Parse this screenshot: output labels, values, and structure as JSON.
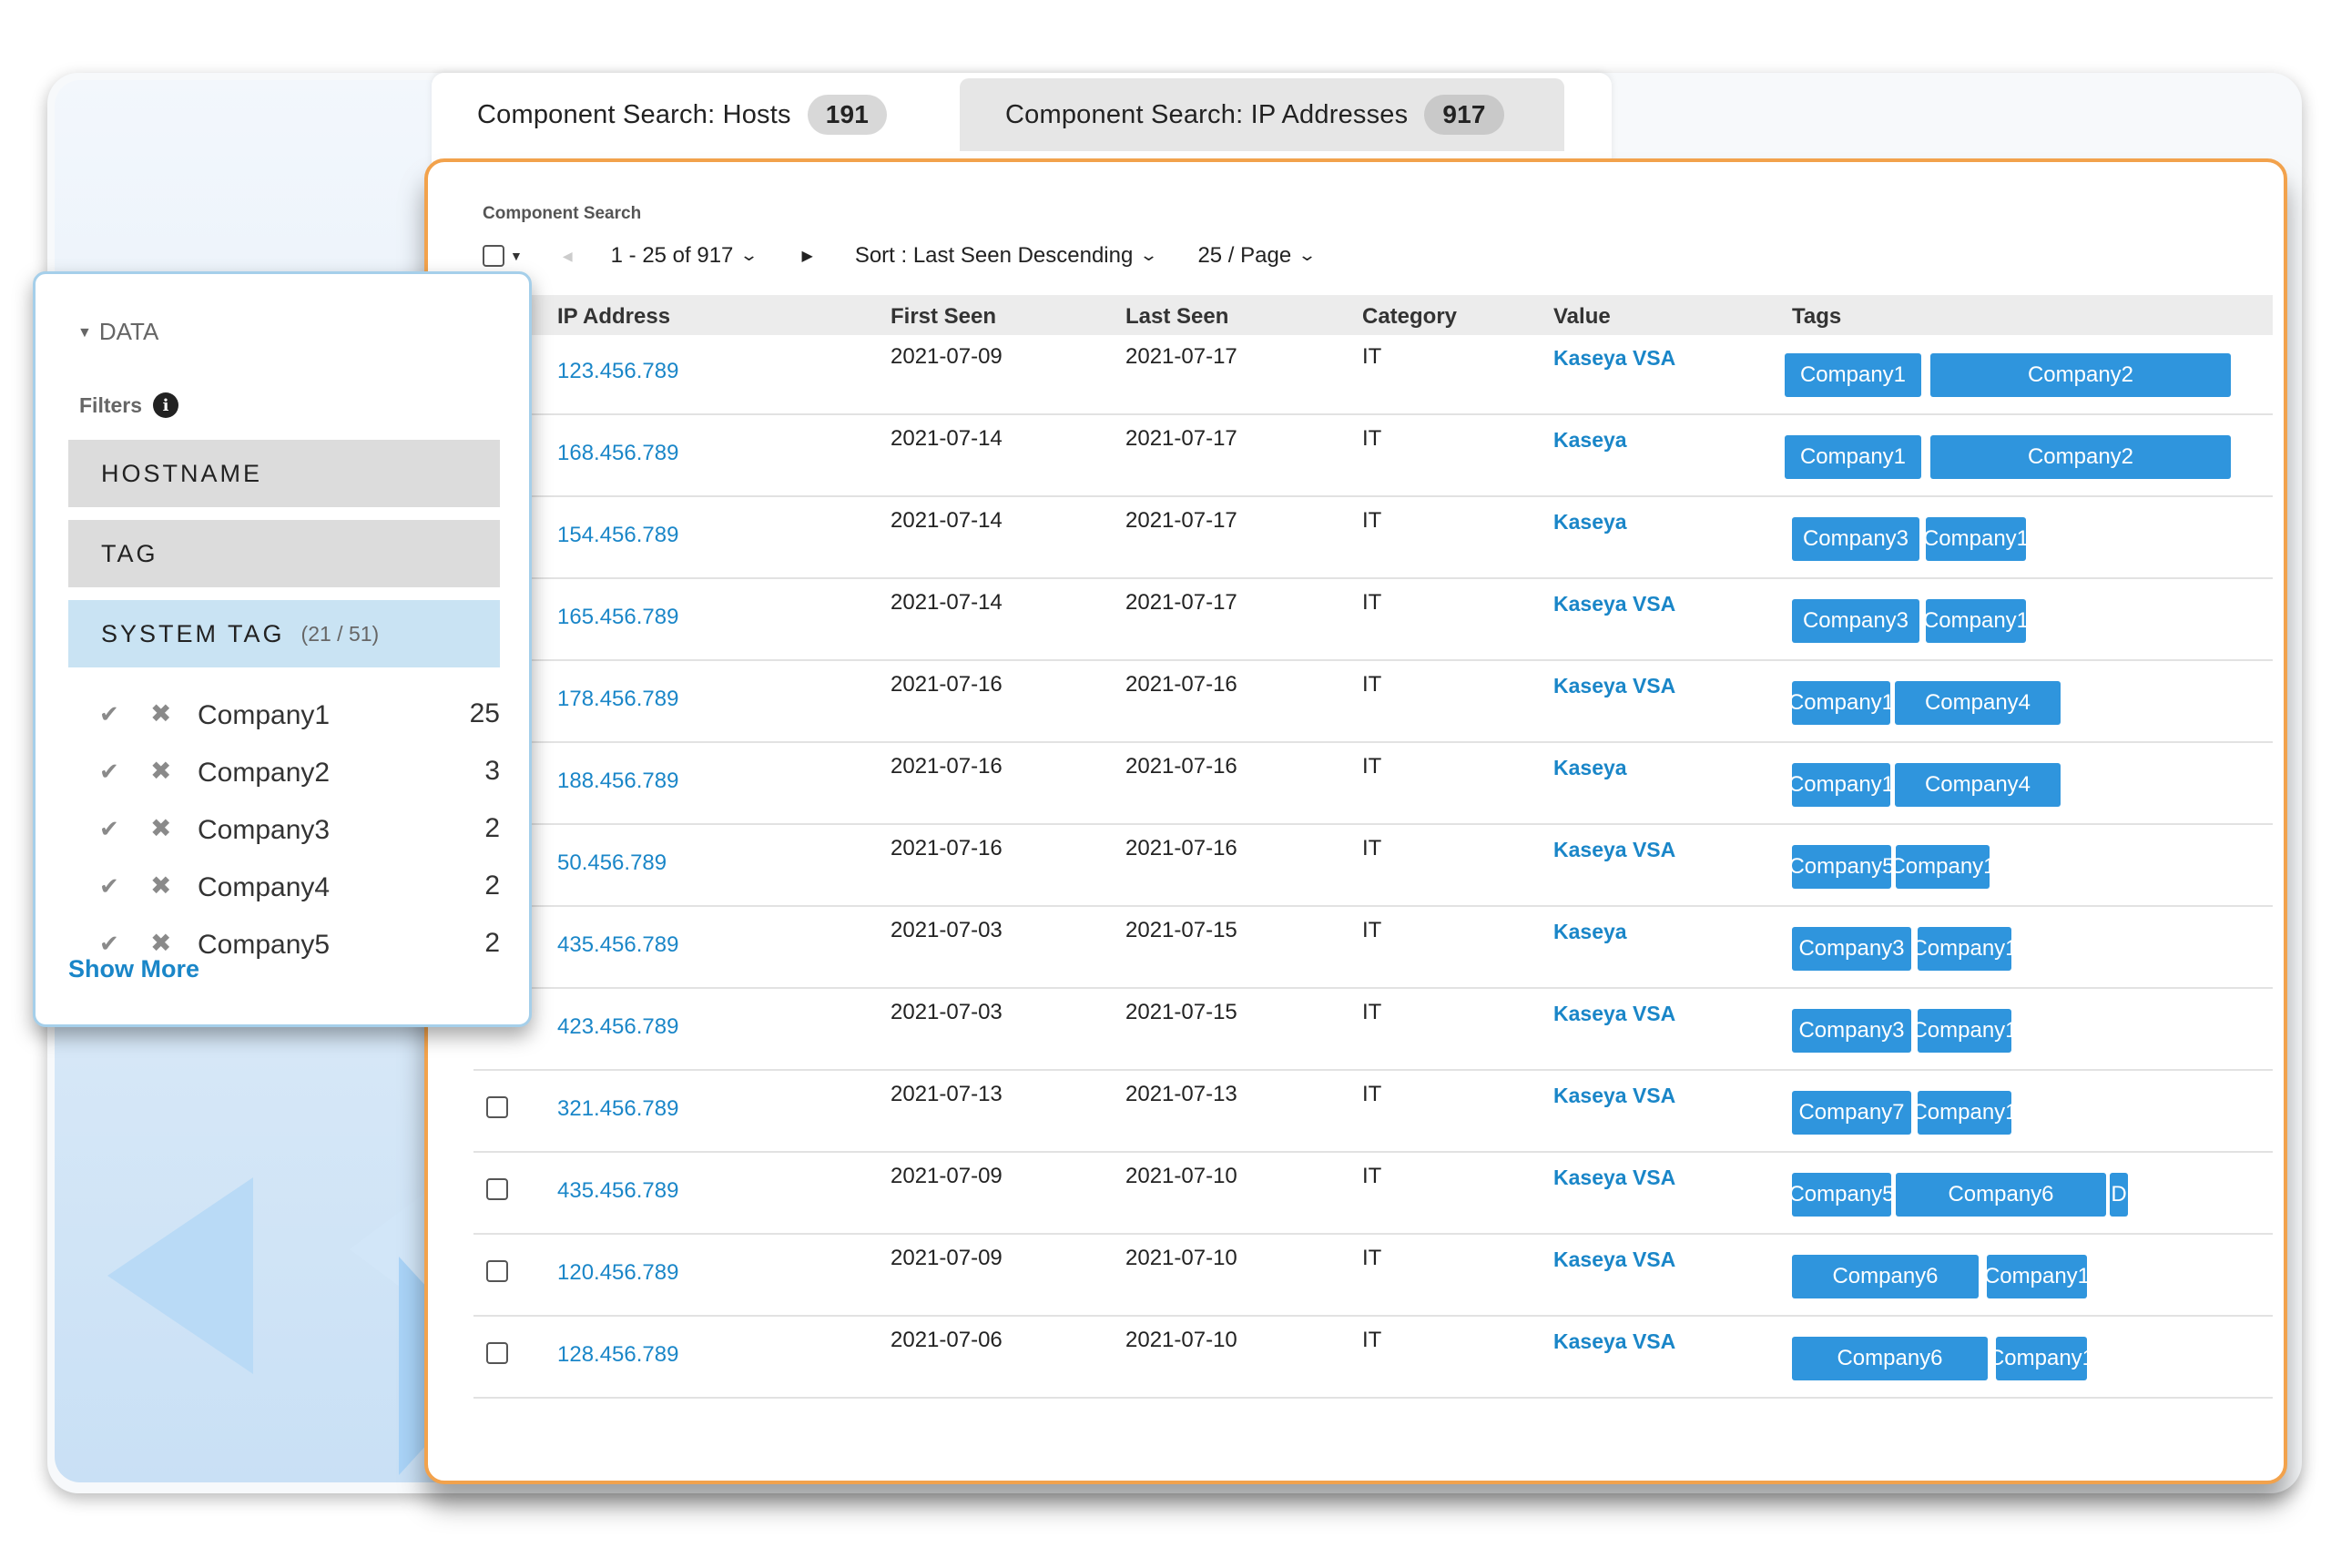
{
  "tabs": [
    {
      "label": "Component Search: Hosts",
      "count": "191"
    },
    {
      "label": "Component Search: IP Addresses",
      "count": "917"
    }
  ],
  "search": {
    "section_label": "Component Search",
    "range": "1 - 25 of 917",
    "sort": "Sort : Last Seen Descending",
    "page_size": "25 / Page"
  },
  "table": {
    "headers": [
      "IP Address",
      "First Seen",
      "Last Seen",
      "Category",
      "Value",
      "Tags"
    ],
    "rows": [
      {
        "ip": "123.456.789",
        "first": "2021-07-09",
        "last": "2021-07-17",
        "category": "IT",
        "value": "Kaseya VSA",
        "tags": [
          "Company1",
          "Company2"
        ]
      },
      {
        "ip": "168.456.789",
        "first": "2021-07-14",
        "last": "2021-07-17",
        "category": "IT",
        "value": "Kaseya",
        "tags": [
          "Company1",
          "Company2"
        ]
      },
      {
        "ip": "154.456.789",
        "first": "2021-07-14",
        "last": "2021-07-17",
        "category": "IT",
        "value": "Kaseya",
        "tags": [
          "Company3",
          "Company1"
        ]
      },
      {
        "ip": "165.456.789",
        "first": "2021-07-14",
        "last": "2021-07-17",
        "category": "IT",
        "value": "Kaseya VSA",
        "tags": [
          "Company3",
          "Company1"
        ]
      },
      {
        "ip": "178.456.789",
        "first": "2021-07-16",
        "last": "2021-07-16",
        "category": "IT",
        "value": "Kaseya VSA",
        "tags": [
          "Company1",
          "Company4"
        ]
      },
      {
        "ip": "188.456.789",
        "first": "2021-07-16",
        "last": "2021-07-16",
        "category": "IT",
        "value": "Kaseya",
        "tags": [
          "Company1",
          "Company4"
        ]
      },
      {
        "ip": "50.456.789",
        "first": "2021-07-16",
        "last": "2021-07-16",
        "category": "IT",
        "value": "Kaseya VSA",
        "tags": [
          "Company5",
          "Company1"
        ]
      },
      {
        "ip": "435.456.789",
        "first": "2021-07-03",
        "last": "2021-07-15",
        "category": "IT",
        "value": "Kaseya",
        "tags": [
          "Company3",
          "Company1"
        ]
      },
      {
        "ip": "423.456.789",
        "first": "2021-07-03",
        "last": "2021-07-15",
        "category": "IT",
        "value": "Kaseya VSA",
        "tags": [
          "Company3",
          "Company1"
        ]
      },
      {
        "ip": "321.456.789",
        "first": "2021-07-13",
        "last": "2021-07-13",
        "category": "IT",
        "value": "Kaseya VSA",
        "tags": [
          "Company7",
          "Company1"
        ]
      },
      {
        "ip": "435.456.789",
        "first": "2021-07-09",
        "last": "2021-07-10",
        "category": "IT",
        "value": "Kaseya VSA",
        "tags": [
          "Company5",
          "Company6",
          "D"
        ]
      },
      {
        "ip": "120.456.789",
        "first": "2021-07-09",
        "last": "2021-07-10",
        "category": "IT",
        "value": "Kaseya VSA",
        "tags": [
          "Company6",
          "Company1"
        ]
      },
      {
        "ip": "128.456.789",
        "first": "2021-07-06",
        "last": "2021-07-10",
        "category": "IT",
        "value": "Kaseya VSA",
        "tags": [
          "Company6",
          "Company1"
        ]
      }
    ]
  },
  "filter_panel": {
    "data_label": "DATA",
    "filters_label": "Filters",
    "facets": [
      "HOSTNAME",
      "TAG",
      "SYSTEM TAG"
    ],
    "system_tag_count": "(21 / 51)",
    "items": [
      {
        "name": "Company1",
        "count": "25"
      },
      {
        "name": "Company2",
        "count": "3"
      },
      {
        "name": "Company3",
        "count": "2"
      },
      {
        "name": "Company4",
        "count": "2"
      },
      {
        "name": "Company5",
        "count": "2"
      }
    ],
    "show_more": "Show More"
  },
  "colors": {
    "accent_orange": "#f2a24c",
    "tag_blue": "#2f95dd",
    "link_blue": "#1a86c8",
    "selected_facet": "#c9e3f3"
  }
}
